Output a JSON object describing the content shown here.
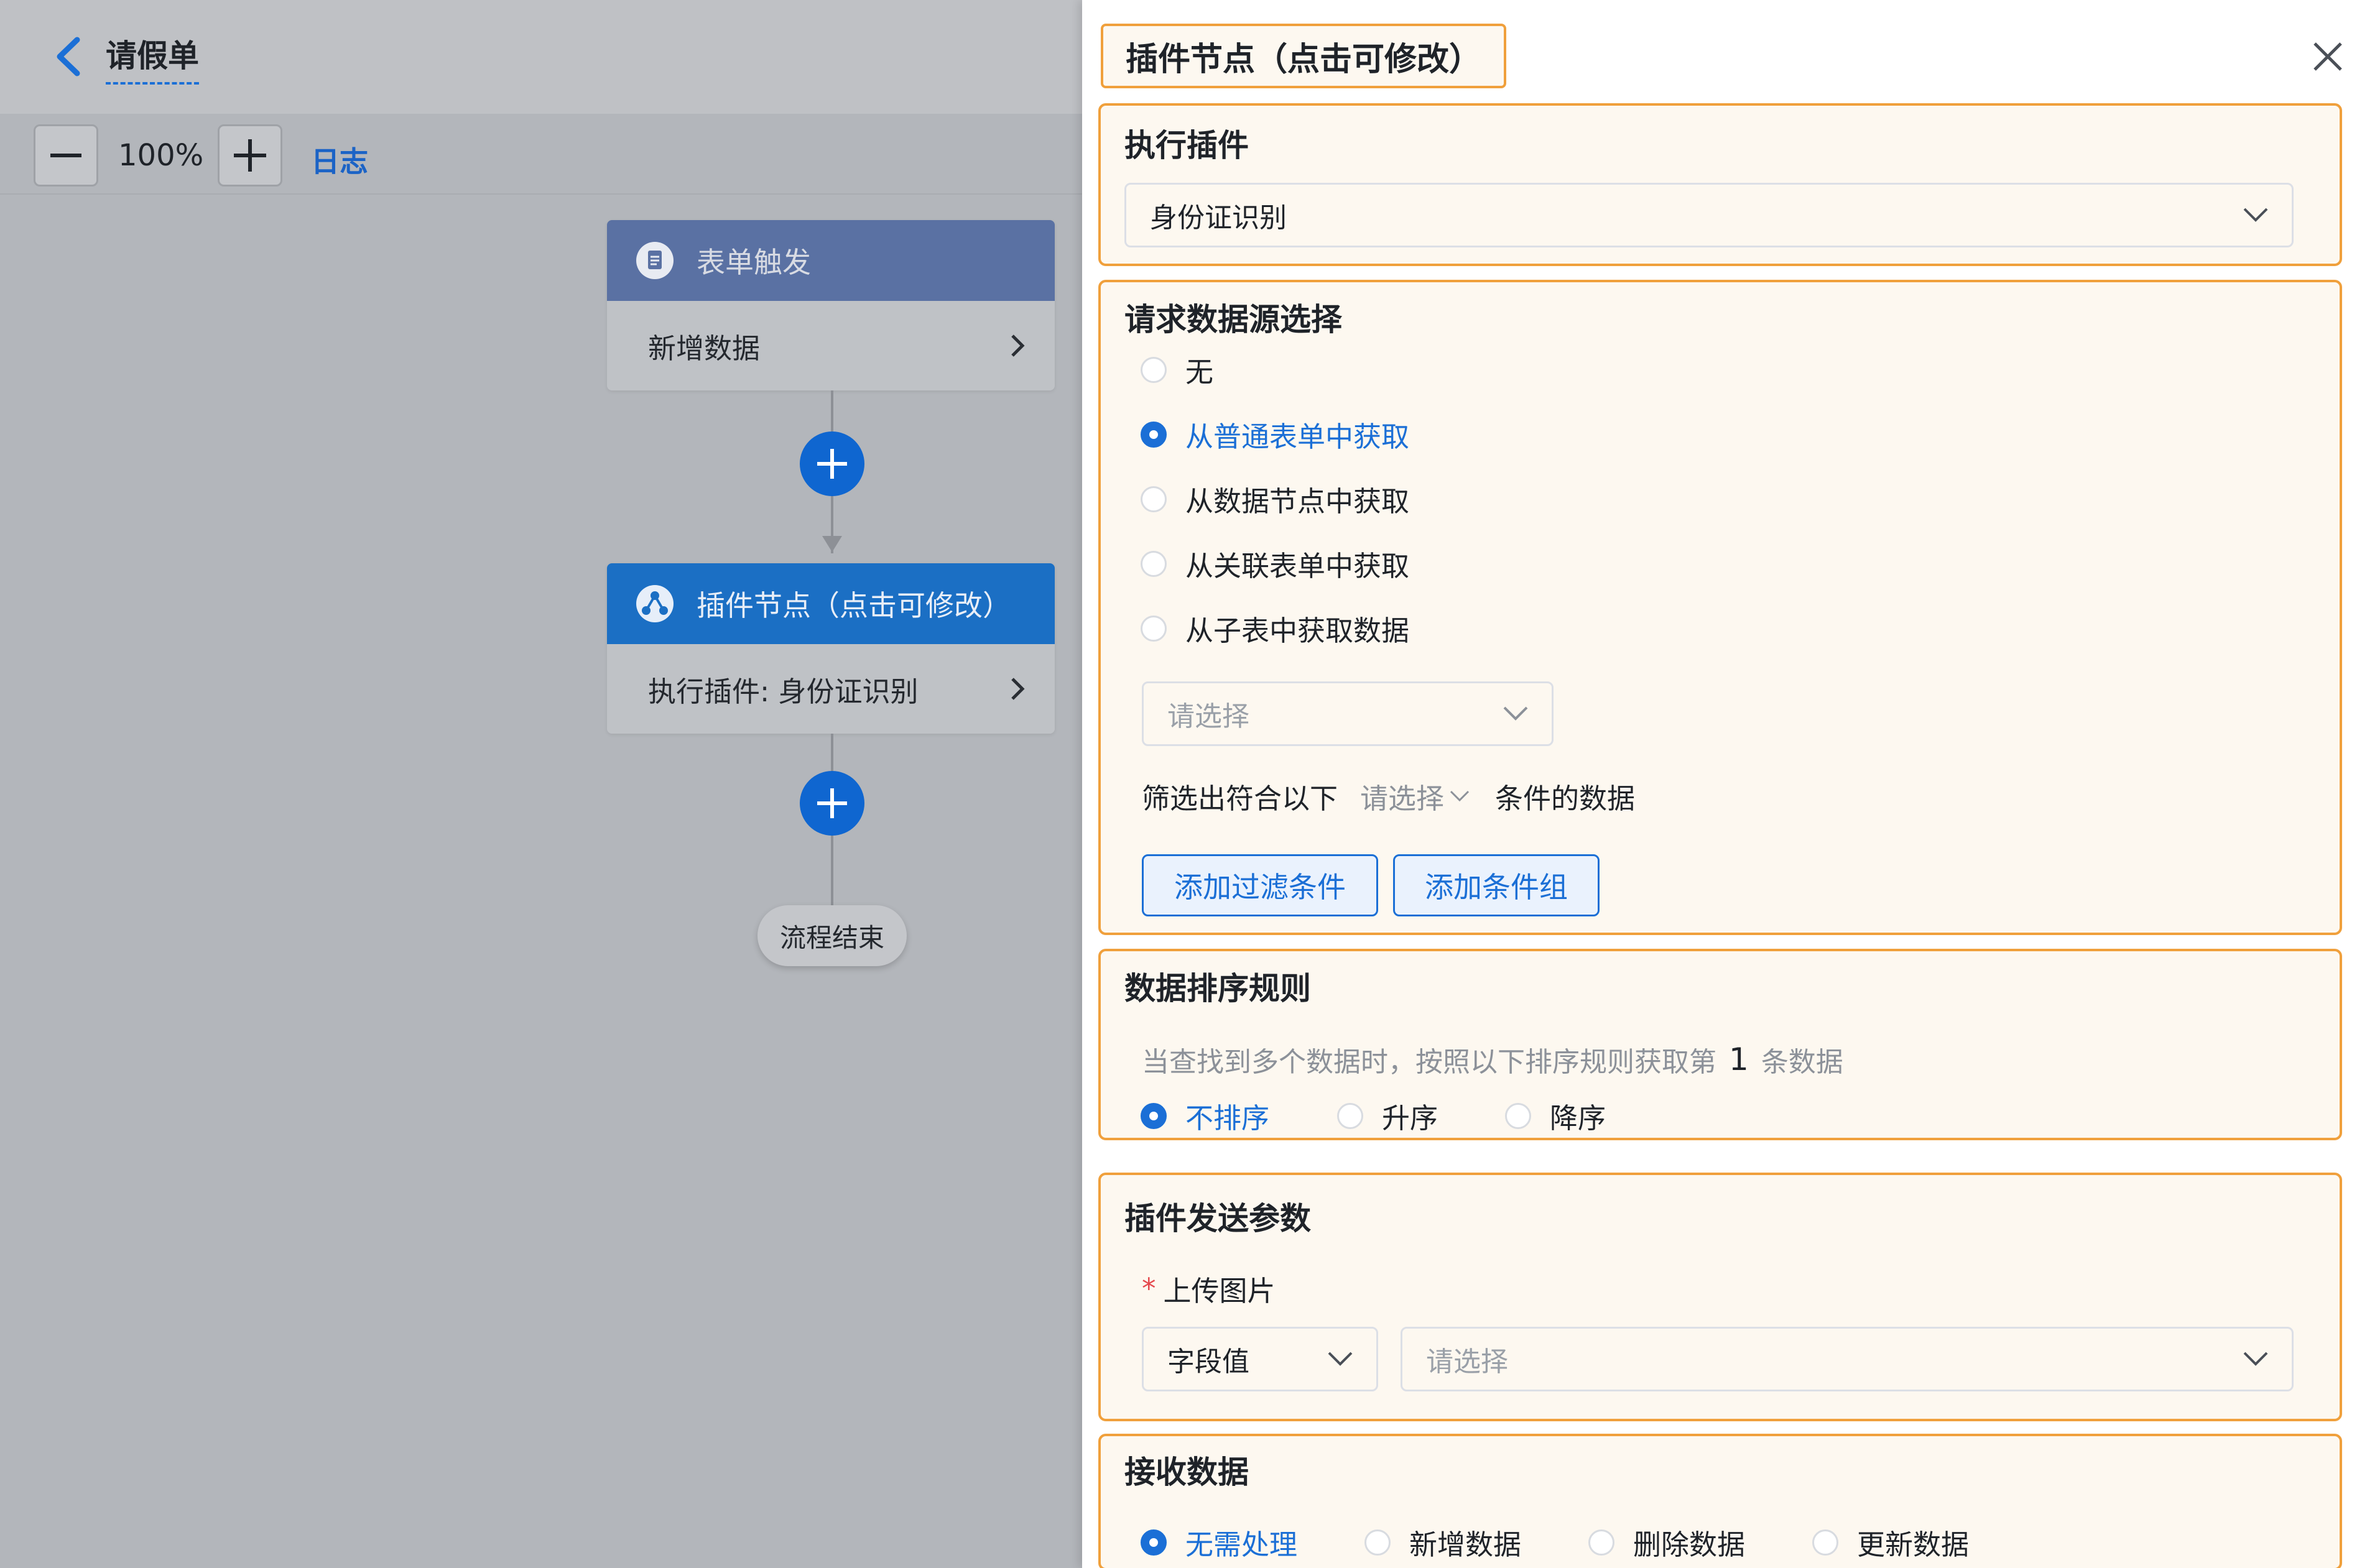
{
  "app": {
    "title": "请假单",
    "zoom": "100%",
    "log_link": "日志"
  },
  "flow": {
    "trigger_node": {
      "title": "表单触发",
      "body": "新增数据"
    },
    "plugin_node": {
      "title": "插件节点（点击可修改）",
      "body": "执行插件: 身份证识别"
    },
    "end_node": "流程结束"
  },
  "panel": {
    "title": "插件节点（点击可修改）",
    "exec_plugin": {
      "title": "执行插件",
      "selected": "身份证识别"
    },
    "data_source": {
      "title": "请求数据源选择",
      "options": [
        "无",
        "从普通表单中获取",
        "从数据节点中获取",
        "从关联表单中获取",
        "从子表中获取数据"
      ],
      "selected_index": 1,
      "form_select_placeholder": "请选择",
      "filter_prefix": "筛选出符合以下",
      "filter_select": "请选择",
      "filter_suffix": "条件的数据",
      "add_filter_button": "添加过滤条件",
      "add_group_button": "添加条件组"
    },
    "sort": {
      "title": "数据排序规则",
      "desc_prefix": "当查找到多个数据时，按照以下排序规则获取第",
      "nth": "1",
      "desc_suffix": "条数据",
      "options": [
        "不排序",
        "升序",
        "降序"
      ],
      "selected_index": 0
    },
    "params": {
      "title": "插件发送参数",
      "required_mark": "*",
      "field_label": "上传图片",
      "type_select": "字段值",
      "value_placeholder": "请选择"
    },
    "receive": {
      "title": "接收数据",
      "options": [
        "无需处理",
        "新增数据",
        "删除数据",
        "更新数据"
      ],
      "selected_index": 0
    }
  },
  "colors": {
    "accent_blue": "#1b6fd6",
    "section_border": "#f0a03c",
    "section_bg": "#fdf8f0",
    "trigger_head": "#5a71a3",
    "plugin_head": "#1b6fc4"
  },
  "icons": [
    "back-chevron-icon",
    "minus-icon",
    "plus-icon",
    "document-icon",
    "plugin-share-icon",
    "chevron-right-icon",
    "add-circle-icon",
    "close-icon",
    "chevron-down-icon"
  ]
}
